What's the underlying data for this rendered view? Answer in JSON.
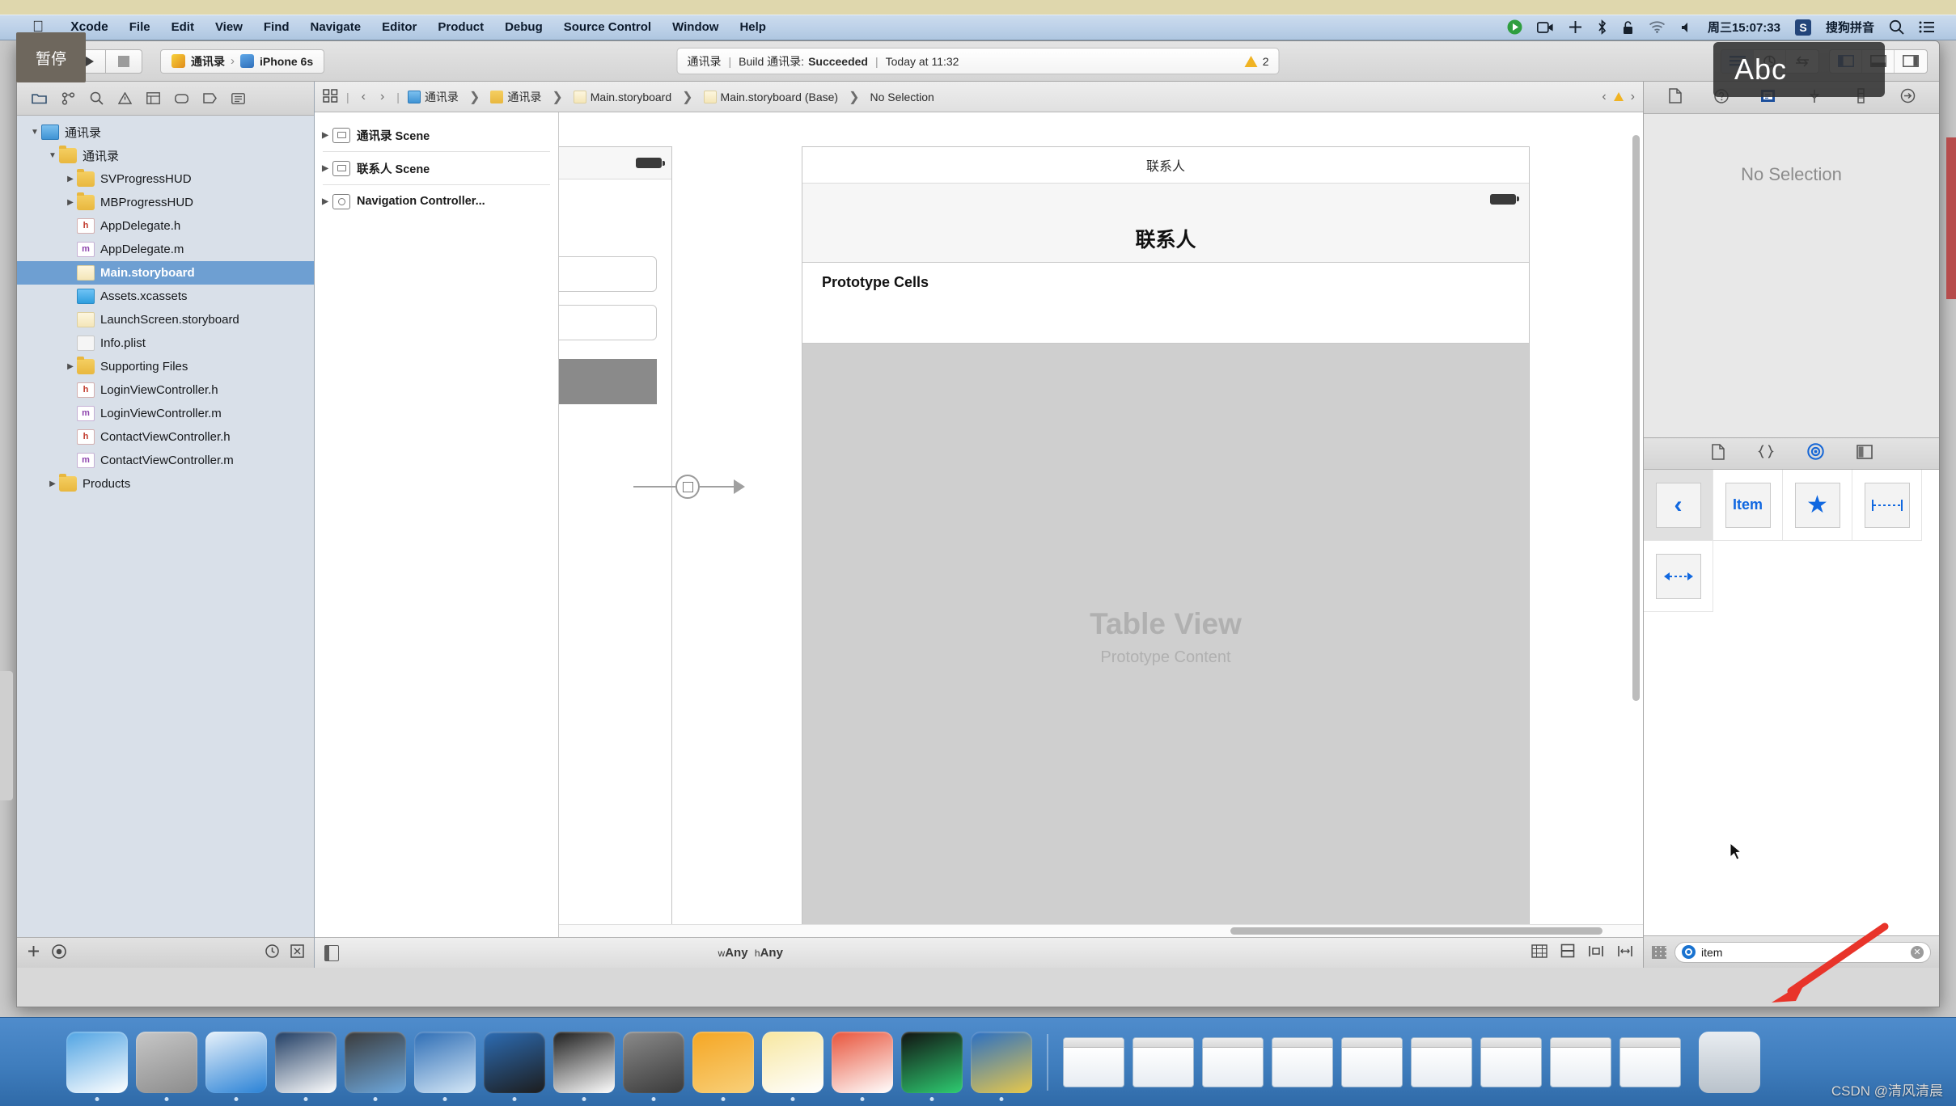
{
  "menubar": {
    "apple_icon": "apple-logo-icon",
    "items": [
      "Xcode",
      "File",
      "Edit",
      "View",
      "Find",
      "Navigate",
      "Editor",
      "Product",
      "Debug",
      "Source Control",
      "Window",
      "Help"
    ],
    "right_icons": [
      "screen-record-icon",
      "camera-icon",
      "airplay-icon",
      "bluetooth-icon",
      "lock-icon",
      "wifi-icon",
      "volume-icon"
    ],
    "clock": "周三15:07:33",
    "input_method_badge": "S",
    "input_method": "搜狗拼音",
    "search_icon": "search-icon",
    "notification_icon": "notification-list-icon"
  },
  "tooltips": {
    "pause": "暂停",
    "abc": "Abc"
  },
  "toolbar": {
    "run_icon": "play-icon",
    "stop_icon": "stop-icon",
    "scheme_project": "通讯录",
    "scheme_separator": "›",
    "scheme_device": "iPhone 6s",
    "status": {
      "project": "通讯录",
      "build_prefix": "Build 通讯录:",
      "build_result": "Succeeded",
      "time": "Today at 11:32",
      "warning_count": "2",
      "warning_icon": "warning-triangle-icon"
    },
    "editor_segment_icons": [
      "standard-editor-icon",
      "assistant-editor-icon",
      "version-editor-icon"
    ],
    "view_segment_icons": [
      "navigator-toggle-icon",
      "debug-toggle-icon",
      "utilities-toggle-icon"
    ]
  },
  "navigator": {
    "tabs": [
      "folder-navigator-icon",
      "source-control-icon",
      "search-icon",
      "issue-navigator-icon",
      "test-navigator-icon",
      "debug-navigator-icon",
      "breakpoint-navigator-icon",
      "report-navigator-icon"
    ],
    "tree": [
      {
        "label": "通讯录",
        "icon": "project-file-icon",
        "depth": 0,
        "twisty": "open",
        "selected": false
      },
      {
        "label": "通讯录",
        "icon": "folder-icon",
        "depth": 1,
        "twisty": "open",
        "selected": false
      },
      {
        "label": "SVProgressHUD",
        "icon": "folder-icon",
        "depth": 2,
        "twisty": "closed",
        "selected": false
      },
      {
        "label": "MBProgressHUD",
        "icon": "folder-icon",
        "depth": 2,
        "twisty": "closed",
        "selected": false
      },
      {
        "label": "AppDelegate.h",
        "icon": "header-file-icon",
        "depth": 2,
        "twisty": "none",
        "selected": false
      },
      {
        "label": "AppDelegate.m",
        "icon": "objc-file-icon",
        "depth": 2,
        "twisty": "none",
        "selected": false
      },
      {
        "label": "Main.storyboard",
        "icon": "storyboard-file-icon",
        "depth": 2,
        "twisty": "none",
        "selected": true
      },
      {
        "label": "Assets.xcassets",
        "icon": "assets-catalog-icon",
        "depth": 2,
        "twisty": "none",
        "selected": false
      },
      {
        "label": "LaunchScreen.storyboard",
        "icon": "storyboard-file-icon",
        "depth": 2,
        "twisty": "none",
        "selected": false
      },
      {
        "label": "Info.plist",
        "icon": "plist-file-icon",
        "depth": 2,
        "twisty": "none",
        "selected": false
      },
      {
        "label": "Supporting Files",
        "icon": "folder-icon",
        "depth": 2,
        "twisty": "closed",
        "selected": false
      },
      {
        "label": "LoginViewController.h",
        "icon": "header-file-icon",
        "depth": 2,
        "twisty": "none",
        "selected": false
      },
      {
        "label": "LoginViewController.m",
        "icon": "objc-file-icon",
        "depth": 2,
        "twisty": "none",
        "selected": false
      },
      {
        "label": "ContactViewController.h",
        "icon": "header-file-icon",
        "depth": 2,
        "twisty": "none",
        "selected": false
      },
      {
        "label": "ContactViewController.m",
        "icon": "objc-file-icon",
        "depth": 2,
        "twisty": "none",
        "selected": false
      },
      {
        "label": "Products",
        "icon": "folder-icon",
        "depth": 1,
        "twisty": "closed",
        "selected": false
      }
    ],
    "bottom": {
      "add_icon": "plus-icon",
      "filter_icon": "filter-circle-icon",
      "recent_icon": "recent-clock-icon",
      "sourcecontrol_icon": "source-control-status-icon"
    }
  },
  "jumpbar": {
    "related_icon": "related-items-icon",
    "back_icon": "chevron-left-icon",
    "forward_icon": "chevron-right-icon",
    "crumbs": [
      {
        "label": "通讯录",
        "icon": "project-file-icon"
      },
      {
        "label": "通讯录",
        "icon": "folder-icon"
      },
      {
        "label": "Main.storyboard",
        "icon": "storyboard-file-icon"
      },
      {
        "label": "Main.storyboard (Base)",
        "icon": "storyboard-base-icon"
      },
      {
        "label": "No Selection",
        "icon": ""
      }
    ],
    "right_icons": [
      "chevron-left-small-icon",
      "warning-triangle-icon",
      "chevron-right-small-icon"
    ]
  },
  "outline": {
    "items": [
      {
        "label": "通讯录 Scene",
        "icon": "scene-icon"
      },
      {
        "label": "联系人 Scene",
        "icon": "scene-icon"
      },
      {
        "label": "Navigation Controller...",
        "icon": "navigation-controller-icon"
      }
    ]
  },
  "canvas": {
    "left_scene": {
      "battery_icon": "battery-icon",
      "fields": 2,
      "button": 1
    },
    "segue": {
      "icon": "segue-relationship-icon"
    },
    "main_scene": {
      "nav_title_top": "联系人",
      "battery_icon": "battery-icon",
      "nav_title": "联系人",
      "prototype_cells_label": "Prototype Cells",
      "table_title": "Table View",
      "table_subtitle": "Prototype Content"
    }
  },
  "editor_bottom": {
    "document_outline_icon": "document-outline-toggle-icon",
    "size_class_w": "w",
    "size_class_w_val": "Any",
    "size_class_h": "h",
    "size_class_h_val": "Any",
    "right_icons": [
      "constraints-icon",
      "align-icon",
      "pin-icon",
      "resolve-issues-icon"
    ]
  },
  "utilities": {
    "inspector_tabs": [
      "file-inspector-icon",
      "quick-help-icon",
      "identity-inspector-icon",
      "attributes-inspector-icon",
      "size-inspector-icon",
      "connections-inspector-icon"
    ],
    "no_selection": "No Selection",
    "library_tabs": [
      "file-template-library-icon",
      "code-snippet-library-icon",
      "object-library-icon",
      "media-library-icon"
    ],
    "library_selected_tab": "object-library-icon",
    "library_items": [
      {
        "name": "bar-button-item-back",
        "label": "",
        "icon": "chevron-left-icon",
        "selected": true
      },
      {
        "name": "bar-button-item",
        "label": "Item",
        "icon": "text-item-icon",
        "selected": false
      },
      {
        "name": "bar-button-item-star",
        "label": "",
        "icon": "star-icon",
        "selected": false
      },
      {
        "name": "fixed-space-bar-button-item",
        "label": "",
        "icon": "fixed-space-icon",
        "selected": false
      },
      {
        "name": "flexible-space-bar-button-item",
        "label": "",
        "icon": "flexible-space-icon",
        "selected": false
      }
    ],
    "filter": {
      "grid_icon": "grid-view-icon",
      "scope_icon": "object-library-circle-icon",
      "value": "item",
      "clear_icon": "clear-x-icon"
    }
  },
  "dock": {
    "items": [
      {
        "name": "finder",
        "colors": [
          "#4fa3e3",
          "#ffffff"
        ]
      },
      {
        "name": "launchpad",
        "colors": [
          "#c7c7c7",
          "#8c8c8c"
        ]
      },
      {
        "name": "safari",
        "colors": [
          "#e8f2fb",
          "#2a82d6"
        ]
      },
      {
        "name": "sequel-pro",
        "colors": [
          "#1f3c63",
          "#ffffff"
        ]
      },
      {
        "name": "quicktime-player",
        "colors": [
          "#3a3a3a",
          "#6ea8dd"
        ]
      },
      {
        "name": "xcode",
        "colors": [
          "#2d6db5",
          "#d6e8f7"
        ]
      },
      {
        "name": "xcode-beta",
        "colors": [
          "#2d6db5",
          "#1c1c1c"
        ]
      },
      {
        "name": "terminal",
        "colors": [
          "#1c1c1c",
          "#ffffff"
        ]
      },
      {
        "name": "system-preferences",
        "colors": [
          "#8a8a8a",
          "#3a3a3a"
        ]
      },
      {
        "name": "sketch",
        "colors": [
          "#f5a623",
          "#f8d07a"
        ]
      },
      {
        "name": "notes",
        "colors": [
          "#f7e7a0",
          "#ffffff"
        ]
      },
      {
        "name": "paw",
        "colors": [
          "#e8533a",
          "#ffffff"
        ]
      },
      {
        "name": "hex-editor",
        "colors": [
          "#111111",
          "#2ecc71"
        ]
      },
      {
        "name": "chrome-canary",
        "colors": [
          "#2a6fc4",
          "#e8c84a"
        ]
      }
    ],
    "window_thumbs": 9,
    "trash": {
      "name": "trash",
      "color": "#d8dde2"
    }
  },
  "watermark": "CSDN @清风清晨"
}
